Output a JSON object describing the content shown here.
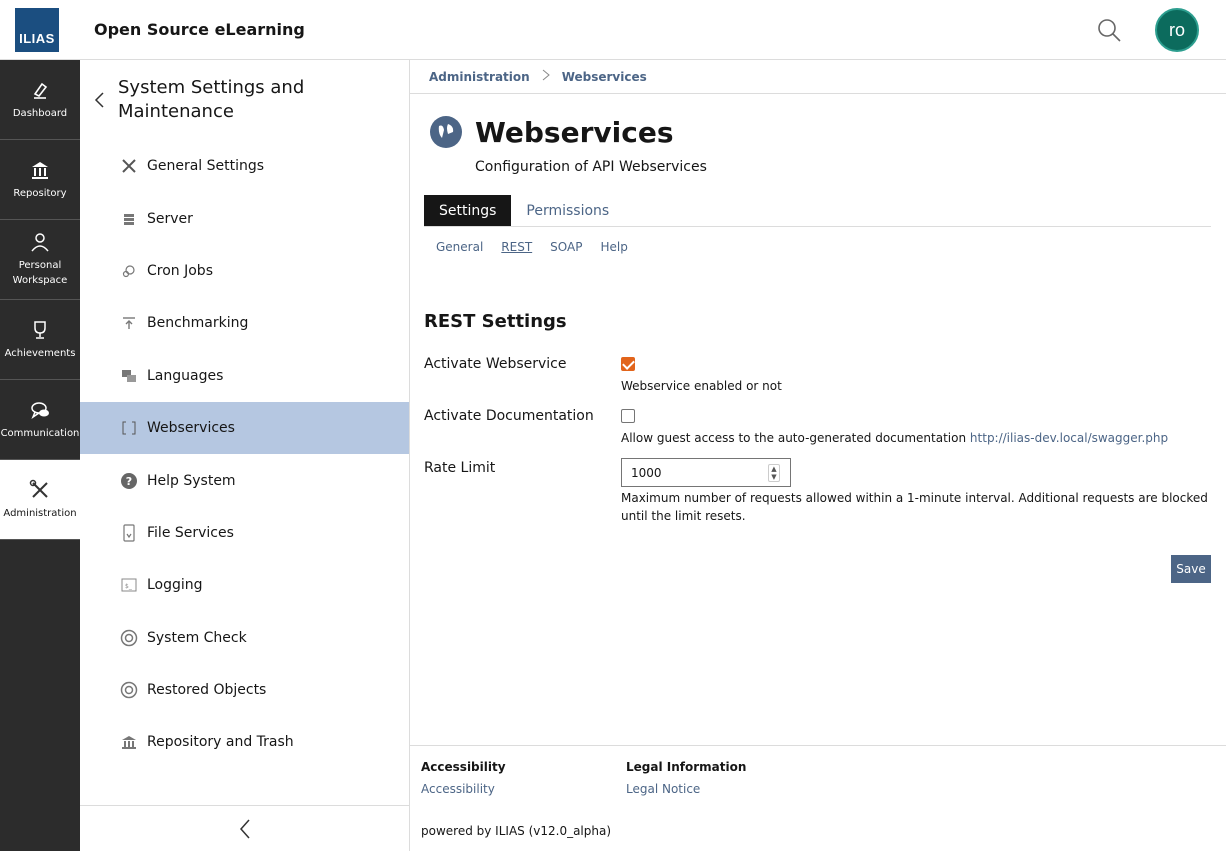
{
  "header": {
    "logo_text": "ILIAS",
    "site_title": "Open Source eLearning",
    "avatar_initials": "ro"
  },
  "mainbar": {
    "items": [
      {
        "label": "Dashboard"
      },
      {
        "label": "Repository"
      },
      {
        "label": "Personal Workspace"
      },
      {
        "label": "Achievements"
      },
      {
        "label": "Communication"
      },
      {
        "label": "Administration"
      }
    ]
  },
  "slate": {
    "title": "System Settings and Maintenance",
    "items": [
      {
        "label": "General Settings",
        "icon": "tools-icon"
      },
      {
        "label": "Server",
        "icon": "server-icon"
      },
      {
        "label": "Cron Jobs",
        "icon": "cron-icon"
      },
      {
        "label": "Benchmarking",
        "icon": "benchmark-icon"
      },
      {
        "label": "Languages",
        "icon": "languages-icon"
      },
      {
        "label": "Webservices",
        "icon": "webservices-icon"
      },
      {
        "label": "Help System",
        "icon": "help-icon"
      },
      {
        "label": "File Services",
        "icon": "file-icon"
      },
      {
        "label": "Logging",
        "icon": "logging-icon"
      },
      {
        "label": "System Check",
        "icon": "lifebuoy-icon"
      },
      {
        "label": "Restored Objects",
        "icon": "lifebuoy-icon"
      },
      {
        "label": "Repository and Trash",
        "icon": "repository-icon"
      }
    ]
  },
  "breadcrumb": {
    "items": [
      "Administration",
      "Webservices"
    ]
  },
  "page": {
    "title": "Webservices",
    "description": "Configuration of API Webservices"
  },
  "tabs": [
    "Settings",
    "Permissions"
  ],
  "subtabs": [
    "General",
    "REST",
    "SOAP",
    "Help"
  ],
  "form": {
    "section_title": "REST Settings",
    "activate_webservice": {
      "label": "Activate Webservice",
      "byline": "Webservice enabled or not",
      "checked": true
    },
    "activate_documentation": {
      "label": "Activate Documentation",
      "byline": "Allow guest access to the auto-generated documentation",
      "link": "http://ilias-dev.local/swagger.php",
      "checked": false
    },
    "rate_limit": {
      "label": "Rate Limit",
      "value": "1000",
      "byline": "Maximum number of requests allowed within a 1-minute interval. Additional requests are blocked until the limit resets."
    },
    "save_label": "Save"
  },
  "footer": {
    "accessibility_heading": "Accessibility",
    "accessibility_link": "Accessibility",
    "legal_heading": "Legal Information",
    "legal_link": "Legal Notice",
    "powered_by": "powered by ILIAS (v12.0_alpha)"
  },
  "colors": {
    "accent": "#4c6586",
    "active_item": "#b5c7e1",
    "mainbar": "#2c2c2c",
    "checkbox": "#e2641b",
    "avatar": "#0c6b5d"
  }
}
